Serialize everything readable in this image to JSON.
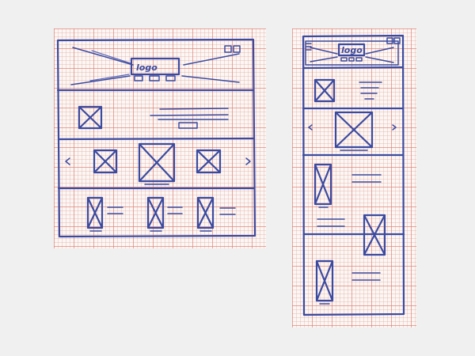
{
  "desktop_wireframe": {
    "header_logo_text": "logo"
  },
  "mobile_wireframe": {
    "header_logo_text": "logo"
  },
  "colors": {
    "ink": "#3b4aa0",
    "paper": "#fbf7f4",
    "grid": "#de786e",
    "background": "#f0f0f0"
  }
}
